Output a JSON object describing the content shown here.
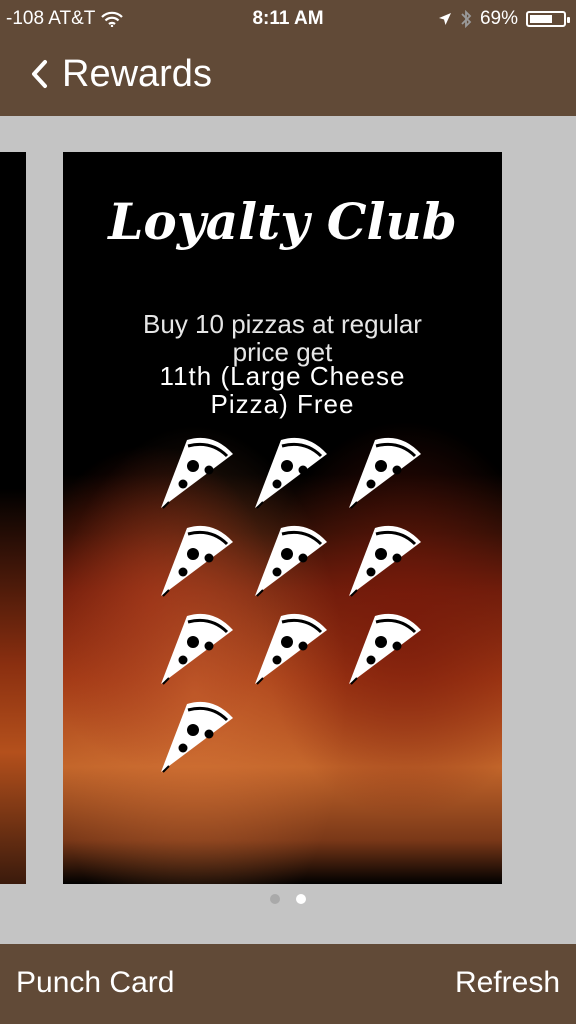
{
  "status_bar": {
    "carrier": "-108 AT&T",
    "time": "8:11 AM",
    "battery": "69%",
    "battery_level": 0.69,
    "icons": [
      "wifi-icon",
      "location-arrow-icon",
      "bluetooth-icon",
      "battery-icon"
    ]
  },
  "nav": {
    "back_icon": "chevron-left-icon",
    "title": "Rewards"
  },
  "card": {
    "title": "Loyalty Club",
    "line1": [
      "Buy 10 pizzas at regular",
      "price get"
    ],
    "line2": [
      "11th (Large Cheese",
      "Pizza) Free"
    ],
    "punch_count": 10,
    "punch_icon": "pizza-slice-icon"
  },
  "pager": {
    "total": 2,
    "active_index": 1
  },
  "toolbar": {
    "left_label": "Punch Card",
    "right_label": "Refresh"
  },
  "colors": {
    "bar_brown": "#614a37",
    "background_gray": "#c4c4c4",
    "card_black": "#000000"
  }
}
